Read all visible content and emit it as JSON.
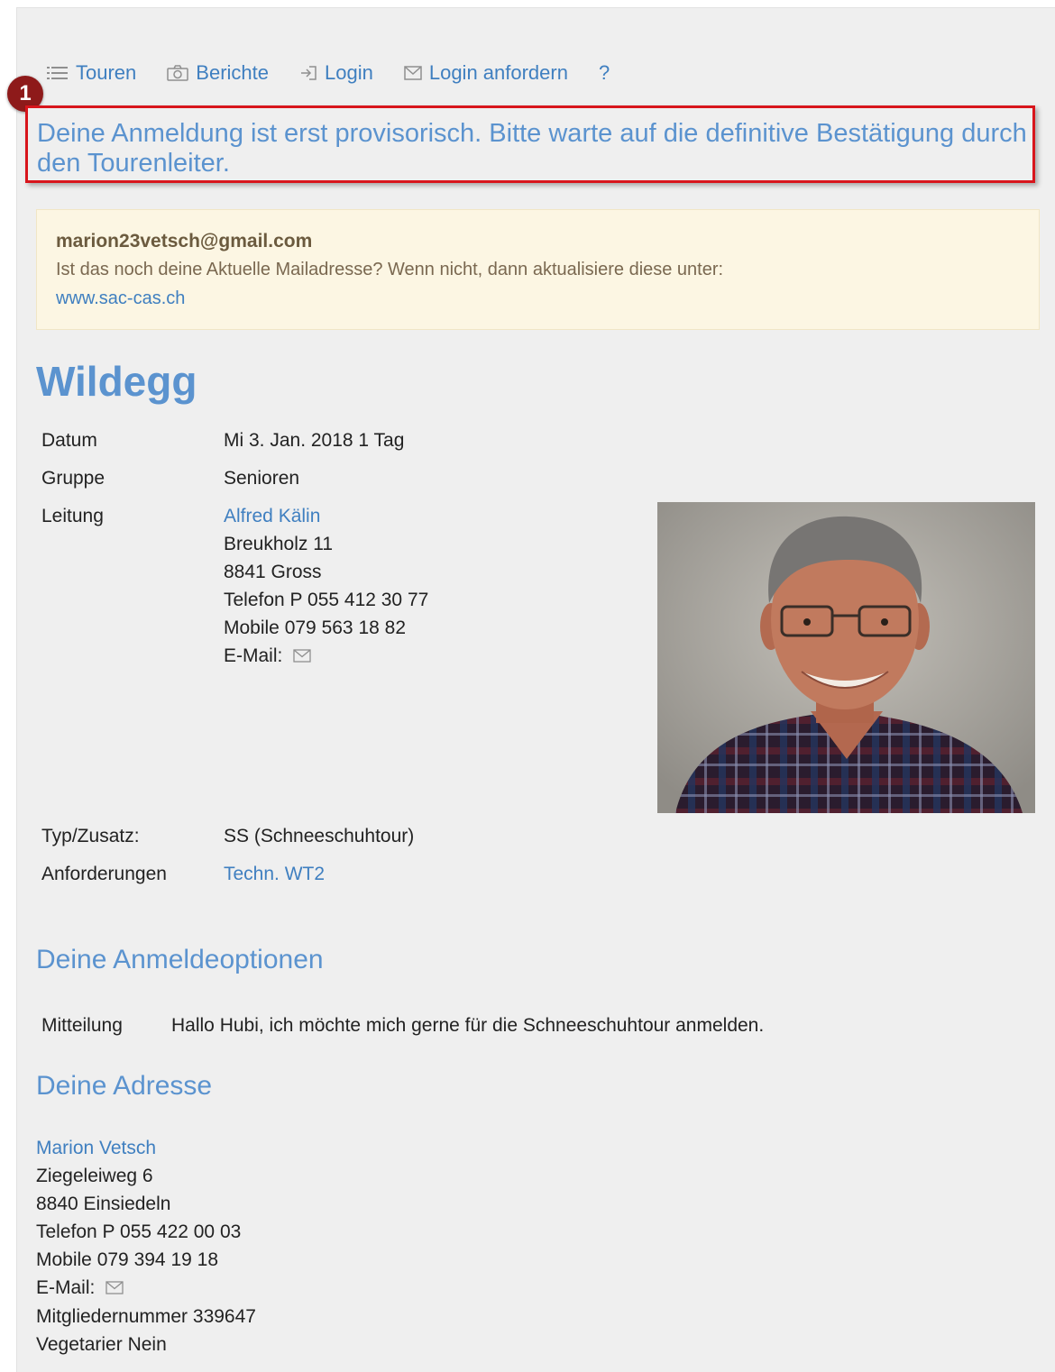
{
  "nav": {
    "items": [
      {
        "label": "Touren",
        "icon": "list-icon"
      },
      {
        "label": "Berichte",
        "icon": "camera-icon"
      },
      {
        "label": "Login",
        "icon": "login-icon"
      },
      {
        "label": "Login anfordern",
        "icon": "mail-icon"
      },
      {
        "label": "?"
      }
    ]
  },
  "marker": {
    "number": "1",
    "color": "#8e1a1a"
  },
  "notice": {
    "text": "Deine Anmeldung ist erst provisorisch. Bitte warte auf die definitive Bestätigung durch den Tourenleiter.",
    "border_color": "#d8151c"
  },
  "mail_box": {
    "email": "marion23vetsch@gmail.com",
    "text": "Ist das noch deine Aktuelle Mailadresse? Wenn nicht, dann aktualisiere diese unter:",
    "link": "www.sac-cas.ch"
  },
  "tour": {
    "title": "Wildegg",
    "datum_label": "Datum",
    "datum": "Mi 3. Jan. 2018 1 Tag",
    "gruppe_label": "Gruppe",
    "gruppe": "Senioren",
    "leitung_label": "Leitung",
    "leiter": {
      "name": "Alfred Kälin",
      "street": "Breukholz 11",
      "city": "8841 Gross",
      "phone": "Telefon P 055 412 30 77",
      "mobile": "Mobile 079 563 18 82",
      "email_label": "E-Mail:"
    },
    "typ_label": "Typ/Zusatz:",
    "typ": "SS (Schneeschuhtour)",
    "anforderungen_label": "Anforderungen",
    "anforderungen": "Techn. WT2"
  },
  "options": {
    "heading": "Deine Anmeldeoptionen",
    "mitteilung_label": "Mitteilung",
    "mitteilung": "Hallo Hubi, ich möchte mich gerne für die Schneeschuhtour anmelden."
  },
  "address": {
    "heading": "Deine Adresse",
    "name": "Marion Vetsch",
    "street": "Ziegeleiweg 6",
    "city": "8840 Einsiedeln",
    "phone": "Telefon P 055 422 00 03",
    "mobile": "Mobile 079 394 19 18",
    "email_label": "E-Mail:",
    "member": "Mitgliedernummer 339647",
    "vegetarian": "Vegetarier Nein"
  },
  "colors": {
    "accent": "#3f7fc0",
    "heading": "#5b93cf",
    "panel": "#efefef",
    "note_bg": "#fcf6e3"
  }
}
